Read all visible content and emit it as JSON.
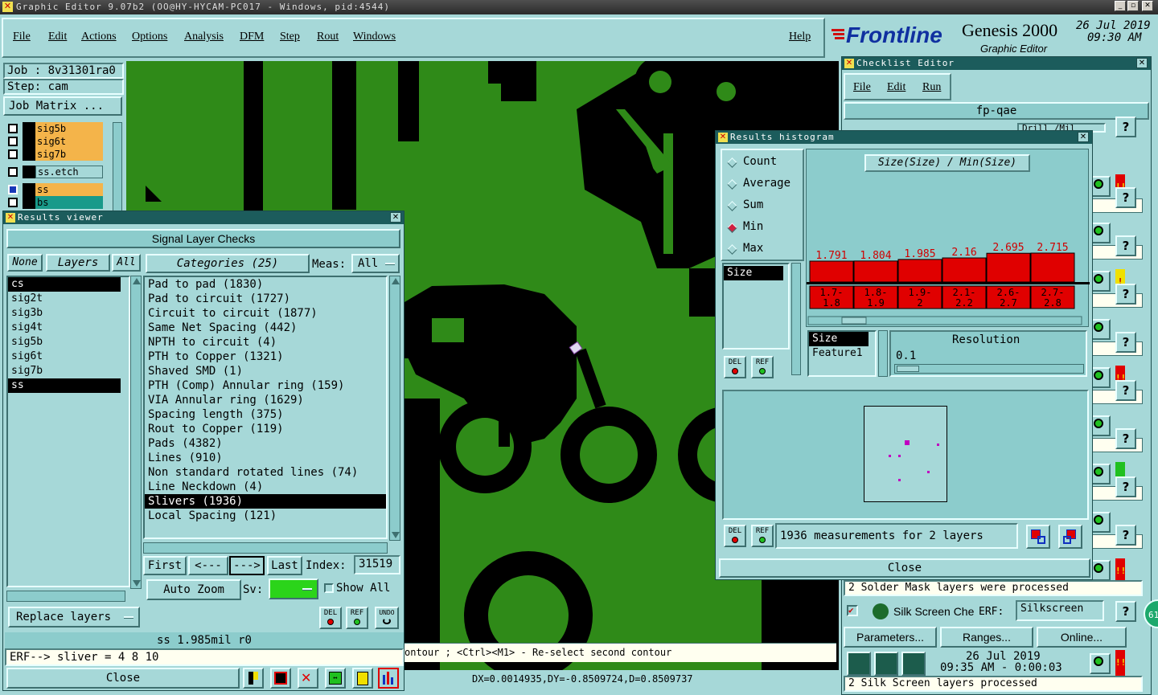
{
  "window": {
    "title": "Graphic Editor 9.07b2 (OO@HY-HYCAM-PC017 - Windows, pid:4544)",
    "min": "_",
    "max": "▫",
    "close": "✕"
  },
  "menu": [
    "File",
    "Edit",
    "Actions",
    "Options",
    "Analysis",
    "DFM",
    "Step",
    "Rout",
    "Windows"
  ],
  "help": "Help",
  "brand": {
    "logo": "Frontline",
    "product": "Genesis 2000",
    "subtitle": "Graphic Editor",
    "date": "26 Jul 2019",
    "time": "09:30 AM"
  },
  "job": {
    "job": "Job : 8v31301ra0",
    "step": "Step: cam",
    "matrix": "Job Matrix ..."
  },
  "layer_list": [
    {
      "name": "sig5b",
      "color": "#f4b44a"
    },
    {
      "name": "sig6t",
      "color": "#f4b44a"
    },
    {
      "name": "sig7b",
      "color": "#f4b44a"
    },
    {
      "name": "ss.etch",
      "color": "#a6d8d8"
    },
    {
      "name": "ss",
      "color": "#f4b44a"
    },
    {
      "name": "bs",
      "color": "#189a8a"
    }
  ],
  "results_viewer": {
    "title": "Results viewer",
    "heading": "Signal Layer Checks",
    "none": "None",
    "layers": "Layers",
    "all": "All",
    "categories_label": "Categories (25)",
    "meas_label": "Meas:",
    "meas_value": "All",
    "layer_items": [
      "cs",
      "sig2t",
      "sig3b",
      "sig4t",
      "sig5b",
      "sig6t",
      "sig7b",
      "ss"
    ],
    "category_items": [
      "Pad to pad (1830)",
      "Pad to circuit (1727)",
      "Circuit to circuit (1877)",
      "Same Net Spacing (442)",
      "NPTH to circuit (4)",
      "PTH to Copper (1321)",
      "Shaved SMD (1)",
      "PTH (Comp) Annular ring (159)",
      "VIA Annular ring (1629)",
      "Spacing length (375)",
      "Rout to Copper (119)",
      "Pads (4382)",
      "Lines (910)",
      "Non standard rotated lines (74)",
      "Line Neckdown (4)",
      "Slivers (1936)",
      "Local Spacing (121)"
    ],
    "first": "First",
    "prev": "<---",
    "next": "--->",
    "last": "Last",
    "index_label": "Index:",
    "index_value": "31519",
    "auto_zoom": "Auto Zoom",
    "sv_label": "Sv:",
    "show_all": "Show All",
    "replace_layers": "Replace layers",
    "del": "DEL",
    "ref": "REF",
    "undo": "UNDO",
    "status": "ss 1.985mil  r0",
    "erf": "ERF--> sliver = 4 8 10",
    "close": "Close"
  },
  "histogram": {
    "title": "Results histogram",
    "modes": [
      "Count",
      "Average",
      "Sum",
      "Min",
      "Max"
    ],
    "selected_mode": "Min",
    "chart_title": "Size(Size) / Min(Size)",
    "list_item": "Size",
    "field_items": [
      "Size",
      "Feature1"
    ],
    "resolution_label": "Resolution",
    "resolution_value": "0.1",
    "del": "DEL",
    "ref": "REF",
    "measurements": "1936 measurements for 2 layers",
    "close": "Close"
  },
  "chart_data": {
    "type": "bar",
    "categories": [
      "1.7-1.8",
      "1.8-1.9",
      "1.9-2",
      "2.1-2.2",
      "2.6-2.7",
      "2.7-2.8"
    ],
    "category_lines": [
      [
        "1.7-",
        "1.8"
      ],
      [
        "1.8-",
        "1.9"
      ],
      [
        "1.9-",
        "2"
      ],
      [
        "2.1-",
        "2.2"
      ],
      [
        "2.6-",
        "2.7"
      ],
      [
        "2.7-",
        "2.8"
      ]
    ],
    "values": [
      1.791,
      1.804,
      1.985,
      2.16,
      2.695,
      2.715
    ],
    "value_labels": [
      "1.791",
      "1.804",
      "1.985",
      "2.16",
      "2.695",
      "2.715"
    ],
    "title": "Size(Size) / Min(Size)",
    "bar_color": "#e00000"
  },
  "checklist": {
    "title": "Checklist Editor",
    "menu": [
      "File",
      "Edit",
      "Run"
    ],
    "name": "fp-qae",
    "drill": "Drill /Mil",
    "solder_msg": "2 Solder Mask layers were processed",
    "silk_name": "Silk Screen Che",
    "erf_label": "ERF:",
    "erf_value": "Silkscreen",
    "parameters": "Parameters...",
    "ranges": "Ranges...",
    "online": "Online...",
    "run_date": "26 Jul 2019",
    "run_time": "09:35 AM - 0:00:03",
    "silk_msg": "2 Silk Screen layers processed",
    "help_glyph": "?",
    "flag": "!!",
    "warn": "!",
    "badge": "61"
  },
  "canvas": {
    "status_hint": "ontour ; <Ctrl><M1> - Re-select second contour",
    "coords": "DX=0.0014935,DY=-0.8509724,D=0.8509737"
  }
}
